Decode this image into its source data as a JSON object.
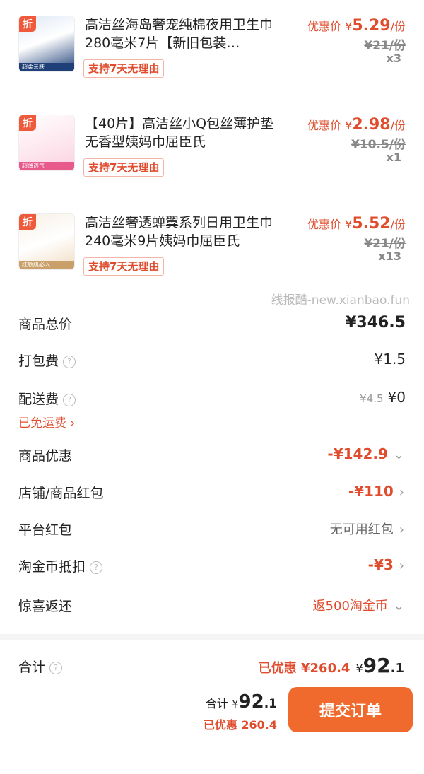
{
  "items": [
    {
      "title": "高洁丝海岛奢宠纯棉夜用卫生巾280毫米7片【新旧包装…",
      "tag": "支持7天无理由",
      "price_label": "优惠价",
      "price": "5.29",
      "unit": "/份",
      "old_price": "¥21/份",
      "qty": "x3",
      "thumb": {
        "discount": "折",
        "color": "#1e3f78",
        "text": "超柔亲肤"
      }
    },
    {
      "title": "【40片】高洁丝小Q包丝薄护垫无香型姨妈巾屈臣氏",
      "tag": "支持7天无理由",
      "price_label": "优惠价",
      "price": "2.98",
      "unit": "/份",
      "old_price": "¥10.5/份",
      "qty": "x1",
      "thumb": {
        "discount": "折",
        "color": "#e85a8c",
        "text": "超薄透气"
      }
    },
    {
      "title": "高洁丝奢透蝉翼系列日用卫生巾240毫米9片姨妈巾屈臣氏",
      "tag": "支持7天无理由",
      "price_label": "优惠价",
      "price": "5.52",
      "unit": "/份",
      "old_price": "¥21/份",
      "qty": "x13",
      "thumb": {
        "discount": "折",
        "color": "#c9a06a",
        "text": "红敏肌必入"
      }
    }
  ],
  "watermark": "线报酷-new.xianbao.fun",
  "summary": {
    "goods_total_label": "商品总价",
    "goods_total": "¥346.5",
    "packing_label": "打包费",
    "packing": "¥1.5",
    "shipping_label": "配送费",
    "shipping_old": "¥4.5",
    "shipping": "¥0",
    "free_shipping": "已免运费 ›",
    "discount_label": "商品优惠",
    "discount": "-¥142.9",
    "shop_coupon_label": "店铺/商品红包",
    "shop_coupon": "-¥110",
    "platform_coupon_label": "平台红包",
    "platform_coupon": "无可用红包",
    "coin_label": "淘金币抵扣",
    "coin": "-¥3",
    "surprise_label": "惊喜返还",
    "surprise": "返500淘金币"
  },
  "total": {
    "label": "合计",
    "saved": "已优惠 ¥260.4",
    "amount_yen": "¥",
    "amount_int": "92",
    "amount_dec": ".1"
  },
  "footer": {
    "total_label": "合计",
    "yen": "¥",
    "int": "92",
    "dec": ".1",
    "saved": "已优惠 260.4",
    "submit": "提交订单"
  },
  "colors": {
    "accent": "#e04d2e",
    "button": "#ef6a2c"
  }
}
